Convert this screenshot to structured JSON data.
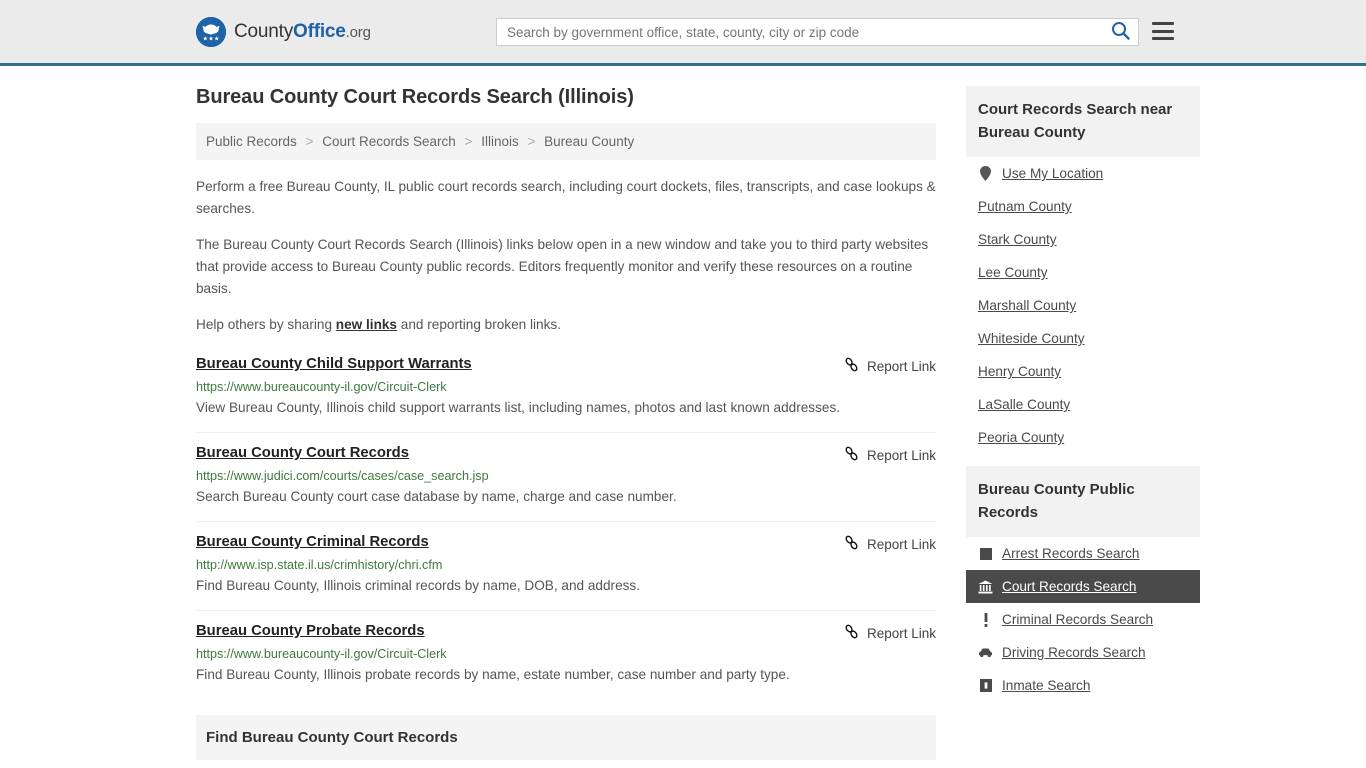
{
  "header": {
    "brand": {
      "prefix": "County",
      "strong": "Office",
      "tld": ".org",
      "logo_icon": "eagle-stars-logo-icon"
    },
    "search": {
      "placeholder": "Search by government office, state, county, city or zip code",
      "value": "",
      "search_icon": "search-icon"
    },
    "menu_icon": "hamburger-menu-icon",
    "accent_color": "#31708f",
    "background_color": "#ebebeb"
  },
  "main": {
    "title": "Bureau County Court Records Search (Illinois)",
    "breadcrumb": [
      "Public Records",
      "Court Records Search",
      "Illinois",
      "Bureau County"
    ],
    "breadcrumb_separator": ">",
    "intro": {
      "paragraph1": "Perform a free Bureau County, IL public court records search, including court dockets, files, transcripts, and case lookups & searches.",
      "paragraph2": "The Bureau County Court Records Search (Illinois) links below open in a new window and take you to third party websites that provide access to Bureau County public records. Editors frequently monitor and verify these resources on a routine basis.",
      "paragraph3_before": "Help others by sharing ",
      "paragraph3_link": "new links",
      "paragraph3_after": " and reporting broken links."
    },
    "report_link_label": "Report Link",
    "report_link_icon": "broken-link-icon",
    "results": [
      {
        "title": "Bureau County Child Support Warrants",
        "url": "https://www.bureaucounty-il.gov/Circuit-Clerk",
        "description": "View Bureau County, Illinois child support warrants list, including names, photos and last known addresses."
      },
      {
        "title": "Bureau County Court Records",
        "url": "https://www.judici.com/courts/cases/case_search.jsp",
        "description": "Search Bureau County court case database by name, charge and case number."
      },
      {
        "title": "Bureau County Criminal Records",
        "url": "http://www.isp.state.il.us/crimhistory/chri.cfm",
        "description": "Find Bureau County, Illinois criminal records by name, DOB, and address."
      },
      {
        "title": "Bureau County Probate Records",
        "url": "https://www.bureaucounty-il.gov/Circuit-Clerk",
        "description": "Find Bureau County, Illinois probate records by name, estate number, case number and party type."
      }
    ],
    "find_heading": "Find Bureau County Court Records",
    "url_color": "#3d7a3d"
  },
  "sidebar": {
    "nearby": {
      "heading": "Court Records Search near Bureau County",
      "use_my_location": {
        "label": "Use My Location",
        "icon": "map-pin-icon"
      },
      "counties": [
        "Putnam County",
        "Stark County",
        "Lee County",
        "Marshall County",
        "Whiteside County",
        "Henry County",
        "LaSalle County",
        "Peoria County"
      ]
    },
    "public_records": {
      "heading": "Bureau County Public Records",
      "items": [
        {
          "label": "Arrest Records Search",
          "icon": "square-icon",
          "active": false
        },
        {
          "label": "Court Records Search",
          "icon": "courthouse-icon",
          "active": true
        },
        {
          "label": "Criminal Records Search",
          "icon": "exclamation-icon",
          "active": false
        },
        {
          "label": "Driving Records Search",
          "icon": "car-icon",
          "active": false
        },
        {
          "label": "Inmate Search",
          "icon": "inmate-icon",
          "active": false
        }
      ],
      "active_background": "#4a4a4a"
    }
  }
}
